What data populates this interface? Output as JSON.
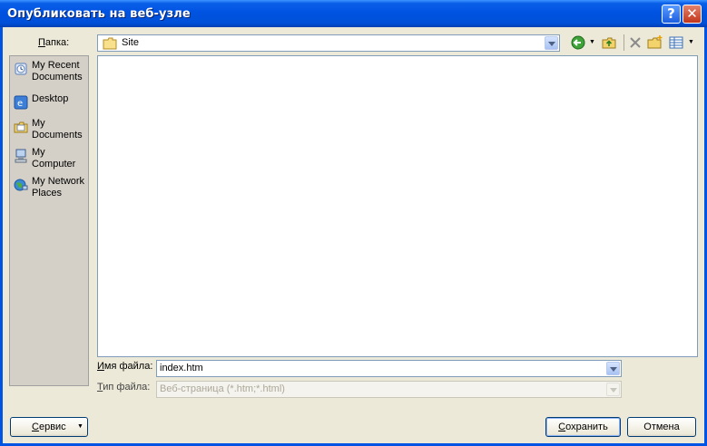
{
  "window": {
    "title": "Опубликовать на веб-узле",
    "help_label": "?",
    "close_label": "✕"
  },
  "folder": {
    "label_u": "П",
    "label_rest": "апка:",
    "value": "Site"
  },
  "toolbar": {
    "icons": [
      "back-icon",
      "up-folder-icon",
      "delete-icon",
      "new-folder-icon",
      "views-icon"
    ]
  },
  "places": [
    {
      "id": "recent",
      "label": "My Recent\nDocuments",
      "icon": "recent-documents-icon"
    },
    {
      "id": "desktop",
      "label": "Desktop",
      "icon": "desktop-icon"
    },
    {
      "id": "documents",
      "label": "My\nDocuments",
      "icon": "my-documents-icon"
    },
    {
      "id": "computer",
      "label": "My\nComputer",
      "icon": "my-computer-icon"
    },
    {
      "id": "network",
      "label": "My Network\nPlaces",
      "icon": "network-places-icon"
    }
  ],
  "filename": {
    "label_u": "И",
    "label_rest": "мя файла:",
    "value": "index.htm"
  },
  "filetype": {
    "label_u": "Т",
    "label_rest": "ип файла:",
    "value": "Веб-страница (*.htm;*.html)"
  },
  "buttons": {
    "tools_u": "С",
    "tools_rest": "ервис",
    "save_u": "С",
    "save_rest": "охранить",
    "cancel": "Отмена"
  }
}
